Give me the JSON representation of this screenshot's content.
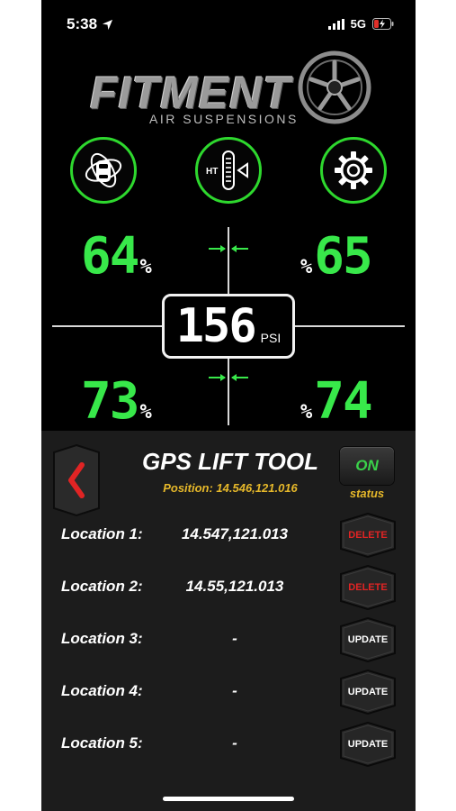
{
  "status_bar": {
    "time": "5:38",
    "network": "5G"
  },
  "logo": {
    "word": "FITMENT",
    "subtitle": "AIR SUSPENSIONS"
  },
  "icons": {
    "left": "car-lift-icon",
    "center": "height-sensor-icon",
    "center_label": "HT",
    "right": "gear-icon"
  },
  "readouts": {
    "front_left": "64",
    "front_right": "65",
    "rear_left": "73",
    "rear_right": "74",
    "percent_unit": "%"
  },
  "pressure": {
    "value": "156",
    "unit": "PSI"
  },
  "gps_tool": {
    "title": "GPS LIFT TOOL",
    "position": "Position: 14.546,121.016",
    "toggle_label": "ON",
    "status_label": "status",
    "locations": [
      {
        "label": "Location 1:",
        "value": "14.547,121.013",
        "action": "DELETE"
      },
      {
        "label": "Location 2:",
        "value": "14.55,121.013",
        "action": "DELETE"
      },
      {
        "label": "Location 3:",
        "value": "-",
        "action": "UPDATE"
      },
      {
        "label": "Location 4:",
        "value": "-",
        "action": "UPDATE"
      },
      {
        "label": "Location 5:",
        "value": "-",
        "action": "UPDATE"
      }
    ]
  },
  "colors": {
    "accent_green": "#38e84a",
    "gold": "#e6b82a",
    "delete_red": "#e02424",
    "panel_bg": "#1c1c1c"
  }
}
